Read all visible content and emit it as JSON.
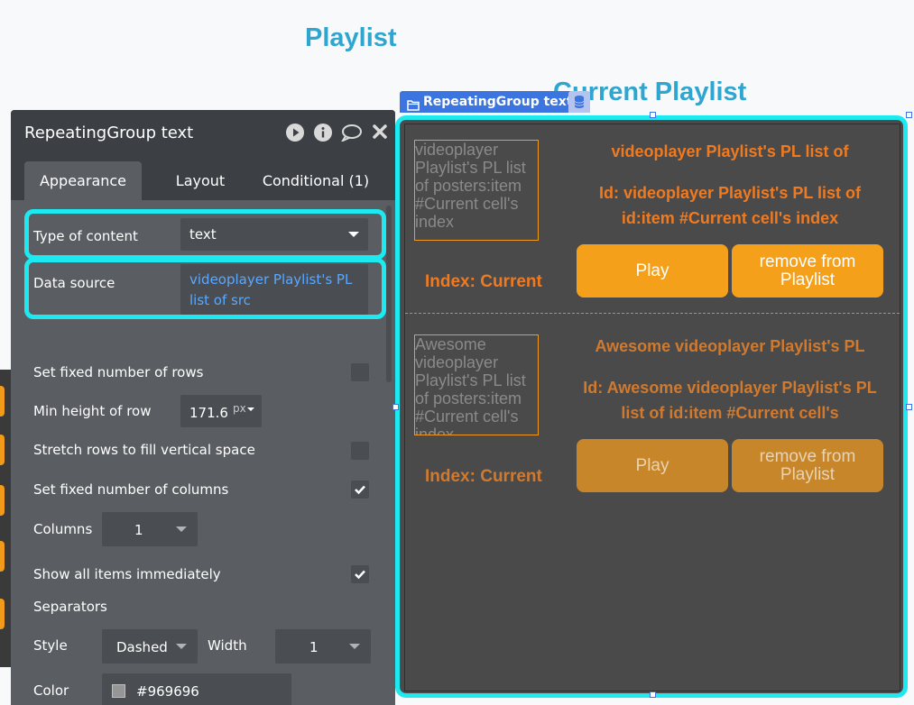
{
  "canvas": {
    "playlist_title": "Playlist",
    "current_playlist_title": "Current Playlist"
  },
  "panel": {
    "title": "RepeatingGroup text",
    "tabs": [
      "Appearance",
      "Layout",
      "Conditional (1)"
    ],
    "type_of_content": {
      "label": "Type of content",
      "value": "text"
    },
    "data_source": {
      "label": "Data source",
      "value": "videoplayer Playlist's PL list of src"
    },
    "set_fixed_rows": {
      "label": "Set fixed number of rows",
      "checked": false
    },
    "min_height_row": {
      "label": "Min height of row",
      "value": "171.6(",
      "unit": "px"
    },
    "stretch_rows": {
      "label": "Stretch rows to fill vertical space",
      "checked": false
    },
    "set_fixed_columns": {
      "label": "Set fixed number of columns",
      "checked": true
    },
    "columns": {
      "label": "Columns",
      "value": "1"
    },
    "show_all_items": {
      "label": "Show all items immediately",
      "checked": true
    },
    "separators": {
      "label": "Separators"
    },
    "style": {
      "label": "Style",
      "value": "Dashed"
    },
    "width": {
      "label": "Width",
      "value": "1"
    },
    "color": {
      "label": "Color",
      "value": "#969696"
    }
  },
  "repeating_group": {
    "tag_label": "RepeatingGroup text",
    "cells": [
      {
        "poster_text": "videoplayer Playlist's PL list of posters:item #Current cell's index",
        "name": "videoplayer Playlist's PL list of",
        "id_text": "Id: videoplayer Playlist's PL list of id:item #Current cell's index",
        "index_text": "Index: Current",
        "play_label": "Play",
        "remove_label": "remove from Playlist"
      },
      {
        "poster_text": "Awesome videoplayer Playlist's PL list of posters:item #Current cell's index",
        "name": "Awesome videoplayer Playlist's PL",
        "id_text": "Id: Awesome videoplayer Playlist's PL list of id:item #Current cell's",
        "index_text": "Index: Current",
        "play_label": "Play",
        "remove_label": "remove from Playlist"
      }
    ]
  },
  "colors": {
    "accent_cyan": "#1de9f0",
    "brand_blue": "#3c74e0",
    "title_blue": "#2fa6cf",
    "orange": "#f5a01a",
    "text_orange": "#f07a20",
    "separator": "#969696"
  }
}
